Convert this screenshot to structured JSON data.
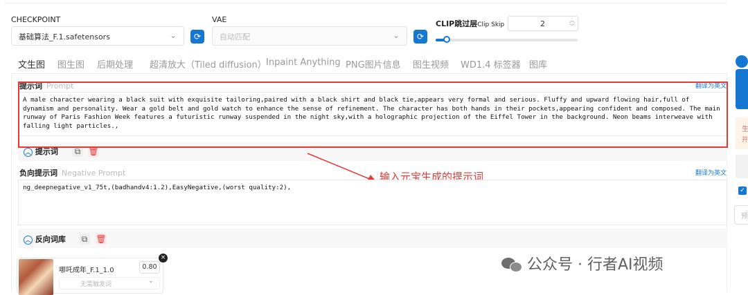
{
  "checkpoint": {
    "label": "CHECKPOINT",
    "value": "基础算法_F.1.safetensors"
  },
  "vae": {
    "label": "VAE",
    "placeholder": "自动匹配"
  },
  "clip": {
    "label": "CLIP跳过层",
    "label_en": "Clip Skip",
    "value": "2",
    "slider_percent": 8
  },
  "tabs": [
    "文生图",
    "图生图",
    "后期处理",
    "超清放大（Tiled diffusion）",
    "Inpaint Anything",
    "PNG图片信息",
    "图生视频",
    "WD1.4 标签器",
    "图库"
  ],
  "prompt": {
    "title": "提示词",
    "subtitle": "Prompt",
    "translate": "翻译为英文",
    "text": "A male character wearing a black suit with exquisite tailoring,paired with a black shirt and black tie,appears very formal and serious. Fluffy and upward flowing hair,full of dynamism and personality. Wear a gold belt and gold watch to enhance the sense of refinement. The character has both hands in their pockets,appearing confident and composed. The main runway of Paris Fashion Week features a futuristic runway suspended in the night sky,with a holographic projection of the Eiffel Tower in the background. Neon beams interweave with falling light particles.,",
    "toggle_label": "提示词"
  },
  "negative": {
    "title": "负向提示词",
    "subtitle": "Negative Prompt",
    "translate": "翻译为英文",
    "text": "ng_deepnegative_v1_75t,(badhandv4:1.2),EasyNegative,(worst quality:2),",
    "toggle_label": "反向词库"
  },
  "annotation": {
    "text": "输入元宝生成的提示词"
  },
  "lora": {
    "name": "哪吒成年_F.1_1.0",
    "weight": "0.80",
    "trigger_placeholder": "无需触发词"
  },
  "watermark": {
    "text": "公众号 · 行者AI视频"
  },
  "right_edge": {
    "text1": "生",
    "text2": "开",
    "text3": "预"
  },
  "colors": {
    "accent": "#1677d2",
    "annotation": "#e53935"
  }
}
